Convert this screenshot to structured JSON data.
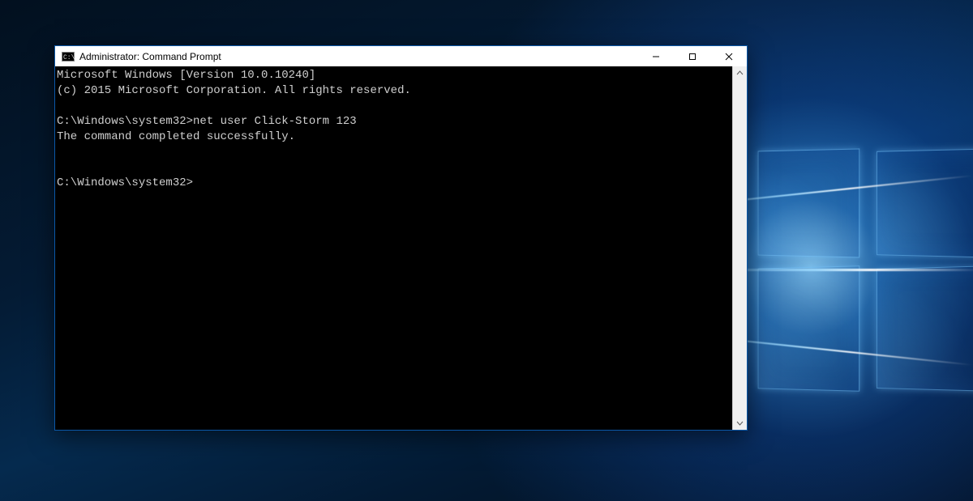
{
  "window": {
    "title": "Administrator: Command Prompt",
    "icon": "cmd-icon",
    "controls": {
      "minimize": "minimize",
      "maximize": "maximize",
      "close": "close"
    }
  },
  "terminal": {
    "lines": [
      "Microsoft Windows [Version 10.0.10240]",
      "(c) 2015 Microsoft Corporation. All rights reserved.",
      "",
      "C:\\Windows\\system32>net user Click-Storm 123",
      "The command completed successfully.",
      "",
      "",
      "C:\\Windows\\system32>"
    ],
    "current_prompt": "C:\\Windows\\system32>"
  },
  "colors": {
    "terminal_bg": "#000000",
    "terminal_fg": "#cfcfcf",
    "window_border": "#0b58a8",
    "titlebar_bg": "#ffffff"
  }
}
